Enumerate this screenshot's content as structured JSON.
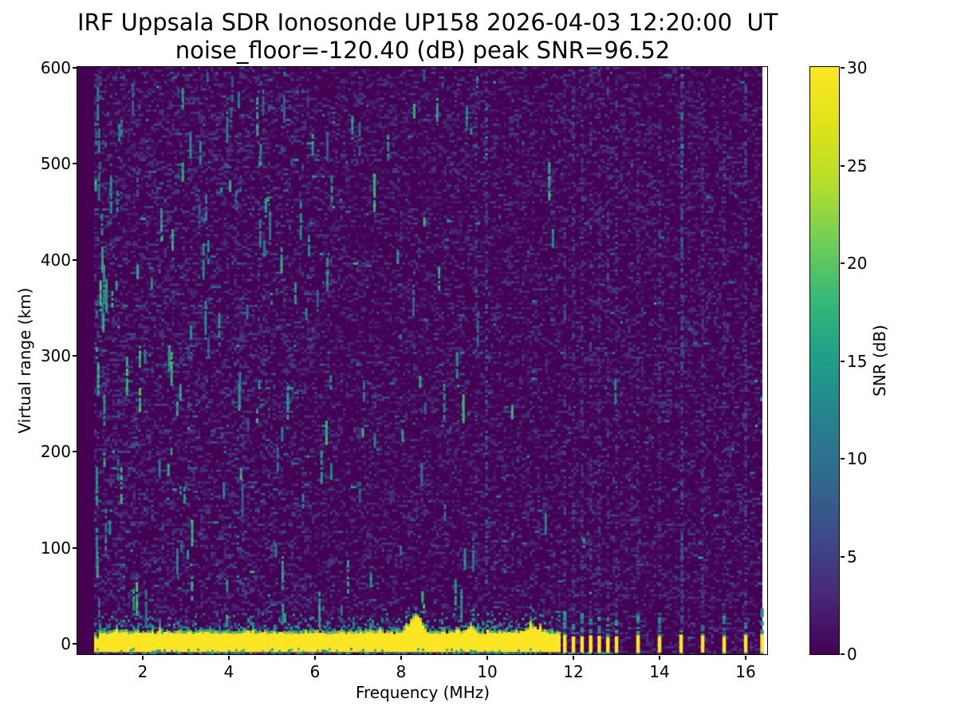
{
  "chart_data": {
    "type": "heatmap",
    "title": "IRF Uppsala SDR Ionosonde UP158 2026-04-03 12:20:00  UT",
    "subtitle": "noise_floor=-120.40 (dB) peak SNR=96.52",
    "xlabel": "Frequency (MHz)",
    "ylabel": "Virtual range (km)",
    "colorbar_label": "SNR (dB)",
    "xticks": [
      2,
      4,
      6,
      8,
      10,
      12,
      14,
      16
    ],
    "yticks": [
      0,
      100,
      200,
      300,
      400,
      500,
      600
    ],
    "colorbar_ticks": [
      0,
      5,
      10,
      15,
      20,
      25,
      30
    ],
    "xlim_mhz": [
      0.48,
      16.52
    ],
    "ylim_km": [
      -10.8,
      601
    ],
    "clim_db": [
      0,
      30
    ],
    "noise_floor_db": -120.4,
    "peak_snr_db": 96.52,
    "colormap": "viridis",
    "colormap_stops": [
      "#440154",
      "#482878",
      "#3e4a89",
      "#31688e",
      "#26828e",
      "#1f9e89",
      "#35b779",
      "#6ece58",
      "#b5de2b",
      "#dde318",
      "#fde725"
    ],
    "colors": {
      "background_db0": "#440154",
      "ground_band": "#fde725",
      "figure_background": "#ffffff",
      "no_data": "#ffffff",
      "spine": "#000000"
    },
    "sweep": {
      "start_mhz": 0.87,
      "continuous_end_mhz": 11.65,
      "stepped_bars_mhz": [
        11.8,
        12.0,
        12.2,
        12.4,
        12.6,
        12.8,
        13.0,
        13.5,
        14.0,
        14.5,
        15.0,
        15.5,
        16.0,
        16.38
      ]
    },
    "ground_band": {
      "top_km": 10.5,
      "bottom_km": -9.2,
      "snr_db": 30
    },
    "echo_bumps": [
      {
        "f_mhz": 8.35,
        "extra_km": 17,
        "sigma_mhz": 0.13
      },
      {
        "f_mhz": 9.62,
        "extra_km": 7,
        "sigma_mhz": 0.08
      },
      {
        "f_mhz": 11.05,
        "extra_km": 6,
        "sigma_mhz": 0.14
      }
    ],
    "rfi_stripes": [
      {
        "f_mhz": 9.74,
        "density": 0.26,
        "db": [
          1.5,
          7
        ]
      },
      {
        "f_mhz": 9.98,
        "density": 0.36,
        "db": [
          2,
          9
        ],
        "hot_top": true
      },
      {
        "f_mhz": 11.8,
        "density": 0.3,
        "db": [
          1.5,
          7
        ]
      },
      {
        "f_mhz": 12.0,
        "density": 0.3,
        "db": [
          1.5,
          7
        ]
      },
      {
        "f_mhz": 12.2,
        "density": 0.3,
        "db": [
          1.5,
          7
        ]
      },
      {
        "f_mhz": 12.4,
        "density": 0.3,
        "db": [
          1.5,
          7
        ]
      },
      {
        "f_mhz": 12.6,
        "density": 0.3,
        "db": [
          1.5,
          7
        ]
      },
      {
        "f_mhz": 12.8,
        "density": 0.3,
        "db": [
          1.5,
          7
        ]
      },
      {
        "f_mhz": 13.0,
        "density": 0.3,
        "db": [
          1.5,
          7
        ]
      },
      {
        "f_mhz": 13.5,
        "density": 0.28,
        "db": [
          1.5,
          6.5
        ]
      },
      {
        "f_mhz": 14.0,
        "density": 0.33,
        "db": [
          1.5,
          7
        ]
      },
      {
        "f_mhz": 14.52,
        "density": 0.6,
        "db": [
          2.5,
          8.5
        ],
        "hot_top": true
      },
      {
        "f_mhz": 15.0,
        "density": 0.34,
        "db": [
          1.5,
          7
        ]
      },
      {
        "f_mhz": 15.5,
        "density": 0.32,
        "db": [
          1.5,
          7
        ]
      },
      {
        "f_mhz": 16.0,
        "density": 0.4,
        "db": [
          2,
          8
        ]
      }
    ],
    "echo_streaks": {
      "count": 175,
      "db": [
        8,
        19
      ],
      "low_freq_weighted": true
    },
    "render_seed": 1337
  }
}
